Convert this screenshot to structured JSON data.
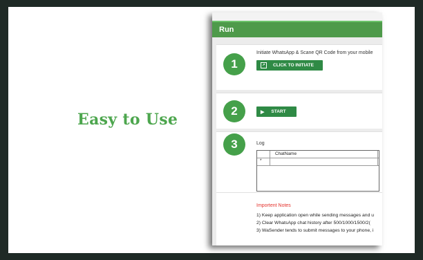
{
  "tagline": "Easy to Use",
  "window": {
    "title": "Run"
  },
  "steps": [
    {
      "number": "1",
      "text": "Initiate WhatsApp & Scane QR Code from your mobile",
      "button": "CLICK TO INITIATE",
      "icon": "external-link-icon"
    },
    {
      "number": "2",
      "button": "START",
      "icon": "play-icon"
    },
    {
      "number": "3",
      "label": "Log",
      "columns": [
        "ChatName"
      ],
      "row_marker": "*"
    }
  ],
  "notes": {
    "title": "Importent Notes",
    "items": [
      "1) Keep application open while sending messages and u",
      "2) Clear WhatsApp chat history after 500/1000/1500/2(",
      "3) WaSender tends to submit messages to your phone, i"
    ]
  },
  "colors": {
    "accent": "#4da64e",
    "header": "#4e9a4a",
    "button": "#2f8a45",
    "notes_title": "#e4322c"
  }
}
